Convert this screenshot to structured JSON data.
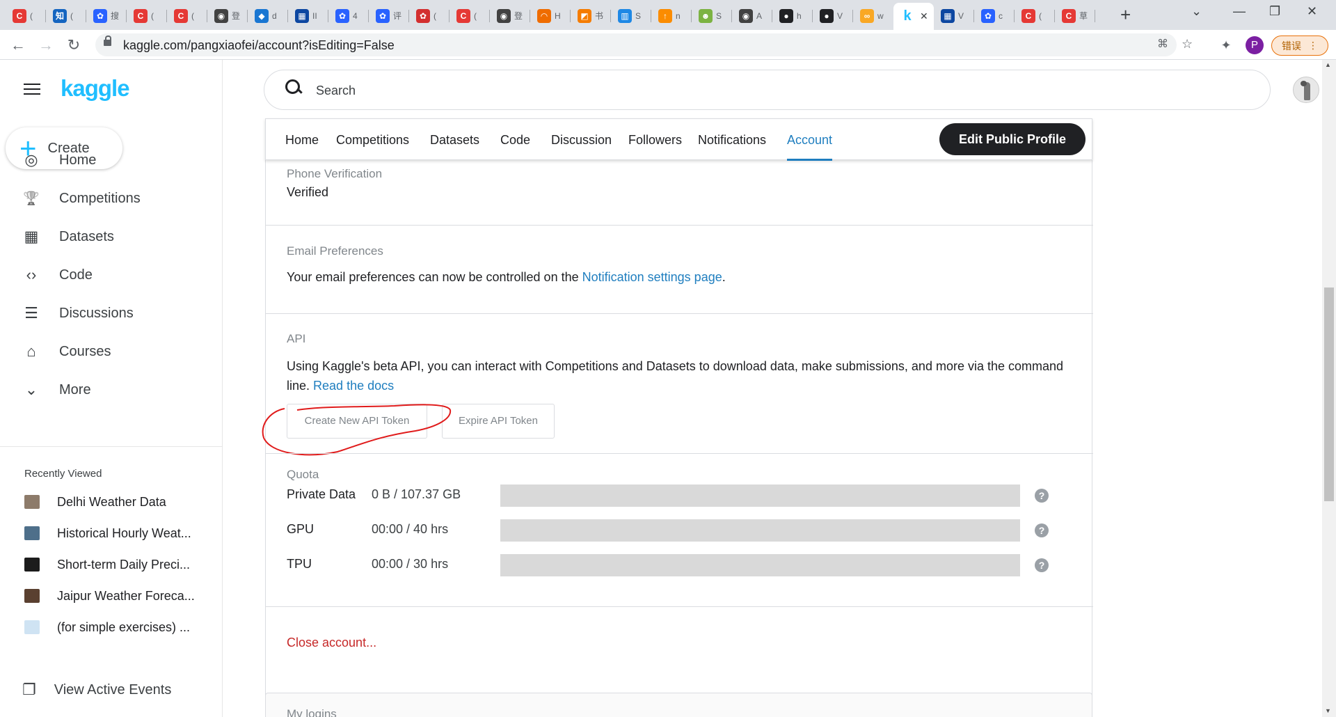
{
  "browser": {
    "tabs": [
      {
        "letter": "C",
        "color": "#e53935",
        "label": "("
      },
      {
        "letter": "知",
        "color": "#1565c0",
        "label": "("
      },
      {
        "letter": "✿",
        "color": "#2962ff",
        "label": "搜"
      },
      {
        "letter": "C",
        "color": "#e53935",
        "label": "("
      },
      {
        "letter": "C",
        "color": "#e53935",
        "label": "("
      },
      {
        "letter": "◉",
        "color": "#424242",
        "label": "登"
      },
      {
        "letter": "◆",
        "color": "#1976d2",
        "label": "d"
      },
      {
        "letter": "▦",
        "color": "#0d47a1",
        "label": "II"
      },
      {
        "letter": "✿",
        "color": "#2962ff",
        "label": "4"
      },
      {
        "letter": "✿",
        "color": "#2962ff",
        "label": "评"
      },
      {
        "letter": "✿",
        "color": "#d32f2f",
        "label": "("
      },
      {
        "letter": "C",
        "color": "#e53935",
        "label": "("
      },
      {
        "letter": "◉",
        "color": "#424242",
        "label": "登"
      },
      {
        "letter": "◠",
        "color": "#ef6c00",
        "label": "H"
      },
      {
        "letter": "◩",
        "color": "#f57c00",
        "label": "书"
      },
      {
        "letter": "▥",
        "color": "#1e88e5",
        "label": "S"
      },
      {
        "letter": "↑",
        "color": "#fb8c00",
        "label": "n"
      },
      {
        "letter": "☻",
        "color": "#7cb342",
        "label": "S"
      },
      {
        "letter": "◉",
        "color": "#424242",
        "label": "A"
      },
      {
        "letter": "●",
        "color": "#202124",
        "label": "h"
      },
      {
        "letter": "●",
        "color": "#202124",
        "label": "V"
      },
      {
        "letter": "∞",
        "color": "#f9a825",
        "label": "w"
      },
      {
        "letter": "k",
        "color": "#20beff",
        "label": "",
        "active": true
      },
      {
        "letter": "▦",
        "color": "#0d47a1",
        "label": "V"
      },
      {
        "letter": "✿",
        "color": "#2962ff",
        "label": "c"
      },
      {
        "letter": "C",
        "color": "#e53935",
        "label": "("
      },
      {
        "letter": "C",
        "color": "#e53935",
        "label": "草"
      }
    ],
    "url": "kaggle.com/pangxiaofei/account?isEditing=False",
    "profile_letter": "P",
    "error_label": "错误"
  },
  "sidebar": {
    "logo": "kaggle",
    "create_label": "Create",
    "nav": [
      {
        "icon": "compass-icon",
        "glyph": "◎",
        "label": "Home"
      },
      {
        "icon": "trophy-icon",
        "glyph": "🏆",
        "label": "Competitions"
      },
      {
        "icon": "table-icon",
        "glyph": "▦",
        "label": "Datasets"
      },
      {
        "icon": "code-icon",
        "glyph": "‹›",
        "label": "Code"
      },
      {
        "icon": "discussion-icon",
        "glyph": "☰",
        "label": "Discussions"
      },
      {
        "icon": "school-icon",
        "glyph": "⌂",
        "label": "Courses"
      },
      {
        "icon": "chevron-down-icon",
        "glyph": "⌄",
        "label": "More"
      }
    ],
    "recently_viewed_title": "Recently Viewed",
    "recently_viewed": [
      {
        "label": "Delhi Weather Data",
        "color": "#8d7b6a"
      },
      {
        "label": "Historical Hourly Weat...",
        "color": "#4e6f8a"
      },
      {
        "label": "Short-term Daily Preci...",
        "color": "#1c1c1c"
      },
      {
        "label": "Jaipur Weather Foreca...",
        "color": "#5a4030"
      },
      {
        "label": "(for simple exercises) ...",
        "color": "#cfe3f3"
      }
    ],
    "events_label": "View Active Events"
  },
  "search": {
    "placeholder": "Search"
  },
  "profile_nav": {
    "tabs": [
      "Home",
      "Competitions",
      "Datasets",
      "Code",
      "Discussion",
      "Followers",
      "Notifications",
      "Account"
    ],
    "active_tab": "Account",
    "edit_button": "Edit Public Profile"
  },
  "account": {
    "phone": {
      "label": "Phone Verification",
      "value": "Verified"
    },
    "email": {
      "label": "Email Preferences",
      "text_prefix": "Your email preferences can now be controlled on the ",
      "link": "Notification settings page",
      "text_suffix": "."
    },
    "api": {
      "label": "API",
      "text_prefix": "Using Kaggle's beta API, you can interact with Competitions and Datasets to download data, make submissions, and more via the command line. ",
      "link": "Read the docs",
      "create_button": "Create New API Token",
      "expire_button": "Expire API Token"
    },
    "quota": {
      "label": "Quota",
      "rows": [
        {
          "name": "Private Data",
          "value": "0 B / 107.37 GB",
          "used_fraction": 0
        },
        {
          "name": "GPU",
          "value": "00:00 / 40 hrs",
          "used_fraction": 0
        },
        {
          "name": "TPU",
          "value": "00:00 / 30 hrs",
          "used_fraction": 0
        }
      ],
      "help_glyph": "?"
    },
    "close_account": "Close account..."
  },
  "logins": {
    "label": "My logins"
  },
  "colors": {
    "kaggle_blue": "#20beff",
    "link_blue": "#1f7ebf",
    "danger_red": "#c62828",
    "annotation_red": "#e01b1b"
  }
}
